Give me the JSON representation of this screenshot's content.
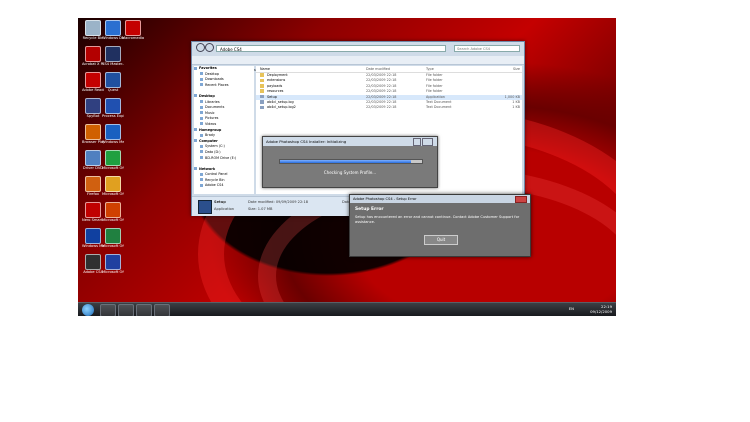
{
  "desktop": {
    "icons": [
      {
        "label": "Recycle Bin",
        "color": "#9bb3c8"
      },
      {
        "label": "Windows Diagnostic...",
        "color": "#2a6fd0"
      },
      {
        "label": "Macromedia Flash Pl...",
        "color": "#c40000"
      },
      {
        "label": "Acrobat X Pro",
        "color": "#b30000"
      },
      {
        "label": "CS4 Master...",
        "color": "#203060"
      },
      {
        "label": "Adobe Reader",
        "color": "#c40000"
      },
      {
        "label": "Quest",
        "color": "#2050a0"
      },
      {
        "label": "SpyBot",
        "color": "#304080"
      },
      {
        "label": "Process Explorer",
        "color": "#2050b0"
      },
      {
        "label": "Browser Player",
        "color": "#d06000"
      },
      {
        "label": "Windows Media",
        "color": "#1a60c0"
      },
      {
        "label": "Driver DVD",
        "color": "#5080c0"
      },
      {
        "label": "Microsoft Office 2007",
        "color": "#20a040"
      },
      {
        "label": "Firefox",
        "color": "#d06010"
      },
      {
        "label": "Microsoft Office Pics",
        "color": "#e0a020"
      },
      {
        "label": "Nero Smart...",
        "color": "#c00000"
      },
      {
        "label": "Microsoft Office Ex...",
        "color": "#d04000"
      },
      {
        "label": "Windows Media Player",
        "color": "#1040a0"
      },
      {
        "label": "Microsoft Office Exc...",
        "color": "#208040"
      },
      {
        "label": "Adobe CS4",
        "color": "#303030"
      },
      {
        "label": "Microsoft Office Po...",
        "color": "#2040a0"
      }
    ]
  },
  "explorer": {
    "address": "Adobe CS4",
    "search_placeholder": "Search Adobe CS4",
    "toolbar": [
      "Organize ▾",
      "Open",
      "Share with ▾",
      "Burn",
      "New folder"
    ],
    "nav": [
      "Favorites",
      "Desktop",
      "Downloads",
      "Recent Places",
      "",
      "Desktop",
      "Libraries",
      "Documents",
      "Music",
      "Pictures",
      "Videos",
      "Homegroup",
      "Brady",
      "Computer",
      "System (C:)",
      "Data (D:)",
      "BD-ROM Drive (E:)",
      "",
      "Network",
      "Control Panel",
      "Recycle Bin",
      "Adobe CS4"
    ],
    "columns": {
      "name": "Name",
      "date": "Date modified",
      "type": "Type",
      "size": "Size"
    },
    "rows": [
      {
        "name": "Deployment",
        "date": "22/03/2009 22:18",
        "type": "File folder",
        "size": ""
      },
      {
        "name": "extensions",
        "date": "22/03/2009 22:18",
        "type": "File folder",
        "size": ""
      },
      {
        "name": "payloads",
        "date": "22/03/2009 22:18",
        "type": "File folder",
        "size": ""
      },
      {
        "name": "resources",
        "date": "22/03/2009 22:18",
        "type": "File folder",
        "size": ""
      },
      {
        "name": "Setup",
        "date": "22/03/2009 22:18",
        "type": "Application",
        "size": "1,000 KB"
      },
      {
        "name": "ab4cl_setup.log",
        "date": "22/03/2009 22:18",
        "type": "Text Document",
        "size": "1 KB"
      },
      {
        "name": "ab4cl_setup.log2",
        "date": "22/03/2009 22:18",
        "type": "Text Document",
        "size": "1 KB"
      }
    ],
    "details": {
      "name": "Setup",
      "type": "Application",
      "modified": "Date modified: 09/09/2009 22:18",
      "size": "Size: 1.07 MB",
      "created": "Date created: 22/03/2009 22:18"
    }
  },
  "progress_dialog": {
    "title": "Adobe Photoshop CS4 Installer: Initializing",
    "status": "Checking System Profile...",
    "progress": 0.92
  },
  "error_dialog": {
    "title": "Adobe Photoshop CS4 - Setup Error",
    "heading": "Setup Error",
    "message": "Setup has encountered an error and cannot continue. Contact Adobe Customer Support for assistance.",
    "ok_label": "Quit"
  },
  "taskbar": {
    "language": "EN",
    "time": "22:19",
    "date": "09/12/2009"
  },
  "colors": {
    "accent": "#2a6fe0",
    "wallpaper_red": "#c40000"
  }
}
